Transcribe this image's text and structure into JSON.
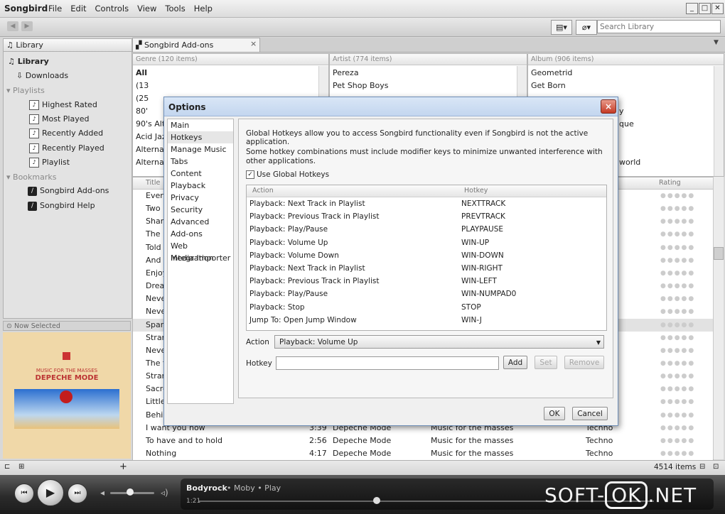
{
  "app": {
    "name": "Songbird",
    "menu": [
      "File",
      "Edit",
      "Controls",
      "View",
      "Tools",
      "Help"
    ],
    "window_controls": [
      "minimize",
      "maximize",
      "close"
    ]
  },
  "toolbar": {
    "search_placeholder": "Search Library"
  },
  "sidebar": {
    "header": "Library",
    "items": [
      {
        "label": "Library",
        "icon": "music-note-icon",
        "group": false
      },
      {
        "label": "Downloads",
        "icon": "download-icon",
        "group": false
      },
      {
        "label": "Playlists",
        "icon": "triangle-icon",
        "group": true
      },
      {
        "label": "Highest Rated",
        "icon": "playlist-icon",
        "group": false
      },
      {
        "label": "Most Played",
        "icon": "playlist-icon",
        "group": false
      },
      {
        "label": "Recently Added",
        "icon": "playlist-icon",
        "group": false
      },
      {
        "label": "Recently Played",
        "icon": "playlist-icon",
        "group": false
      },
      {
        "label": "Playlist",
        "icon": "playlist-icon",
        "group": false
      },
      {
        "label": "Bookmarks",
        "icon": "triangle-icon",
        "group": true
      },
      {
        "label": "Songbird Add-ons",
        "icon": "songbird-icon",
        "group": false
      },
      {
        "label": "Songbird Help",
        "icon": "songbird-icon",
        "group": false
      }
    ],
    "now_selected": "Now Selected",
    "album_art": {
      "line1": "MUSIC FOR THE MASSES",
      "line2": "DEPECHE MODE"
    }
  },
  "tabs": [
    {
      "label": "Songbird Add-ons",
      "close": "×"
    }
  ],
  "filters": {
    "genre": {
      "header": "Genre (120 items)",
      "rows": [
        "All",
        "(13",
        "(25",
        "80'",
        "90's Alte",
        "Acid Jaz",
        "Alternat",
        "Alternat"
      ]
    },
    "artist": {
      "header": "Artist (774 items)",
      "rows": [
        "Pereza",
        "Pet Shop Boys"
      ]
    },
    "album": {
      "header": "Album (906 items)",
      "rows": [
        "Geometrid",
        "Get Born",
        "",
        "y",
        "que",
        "",
        "world"
      ]
    }
  },
  "tracks": {
    "columns": [
      "Title",
      "Rating"
    ],
    "partial_titles": [
      "Every",
      "Two n",
      "Sham",
      "The l",
      "Told",
      "And t",
      "Enjoy",
      "Drea",
      "Neve",
      "Neve",
      "Span",
      "Stran",
      "Neve",
      "The t",
      "Stran",
      "Sacre",
      "Little",
      "Behin"
    ],
    "full_rows": [
      {
        "title": "I want you now",
        "time": "3:39",
        "artist": "Depeche Mode",
        "album": "Music for the masses",
        "genre": "Techno"
      },
      {
        "title": "To have and to hold",
        "time": "2:56",
        "artist": "Depeche Mode",
        "album": "Music for the masses",
        "genre": "Techno"
      },
      {
        "title": "Nothing",
        "time": "4:17",
        "artist": "Depeche Mode",
        "album": "Music for the masses",
        "genre": "Techno"
      }
    ],
    "stars": "●●●●●"
  },
  "status": {
    "items": "4514 items"
  },
  "player": {
    "title": "Bodyrock",
    "rest": "• Moby • Play",
    "position": "1:21",
    "progress": 0.39,
    "volume": 0.45
  },
  "watermark": {
    "a": "SOFT-",
    "b": "OK",
    "c": ".NET"
  },
  "dialog": {
    "title": "Options",
    "close": "×",
    "nav": [
      "Main",
      "Hotkeys",
      "Manage Music",
      "Tabs",
      "Content",
      "Playback",
      "Privacy",
      "Security",
      "Advanced",
      "Add-ons",
      "Web Integration",
      "Media Importer"
    ],
    "selected_nav": "Hotkeys",
    "desc1": "Global Hotkeys allow you to access Songbird functionality even if Songbird is not the active application.",
    "desc2": "Some hotkey combinations must include modifier keys to minimize unwanted interference with other applications.",
    "use_global": "Use Global Hotkeys",
    "use_global_checked": true,
    "table_headers": [
      "Action",
      "Hotkey"
    ],
    "hotkeys": [
      {
        "action": "Playback: Next Track in Playlist",
        "key": "NEXTTRACK"
      },
      {
        "action": "Playback: Previous Track in Playlist",
        "key": "PREVTRACK"
      },
      {
        "action": "Playback: Play/Pause",
        "key": "PLAYPAUSE"
      },
      {
        "action": "Playback: Volume Up",
        "key": "WIN-UP"
      },
      {
        "action": "Playback: Volume Down",
        "key": "WIN-DOWN"
      },
      {
        "action": "Playback: Next Track in Playlist",
        "key": "WIN-RIGHT"
      },
      {
        "action": "Playback: Previous Track in Playlist",
        "key": "WIN-LEFT"
      },
      {
        "action": "Playback: Play/Pause",
        "key": "WIN-NUMPAD0"
      },
      {
        "action": "Playback: Stop",
        "key": "STOP"
      },
      {
        "action": "Jump To: Open Jump Window",
        "key": "WIN-J"
      }
    ],
    "action_label": "Action",
    "action_value": "Playback: Volume Up",
    "hotkey_label": "Hotkey",
    "hotkey_value": "",
    "buttons": {
      "add": "Add",
      "set": "Set",
      "remove": "Remove",
      "ok": "OK",
      "cancel": "Cancel"
    }
  }
}
